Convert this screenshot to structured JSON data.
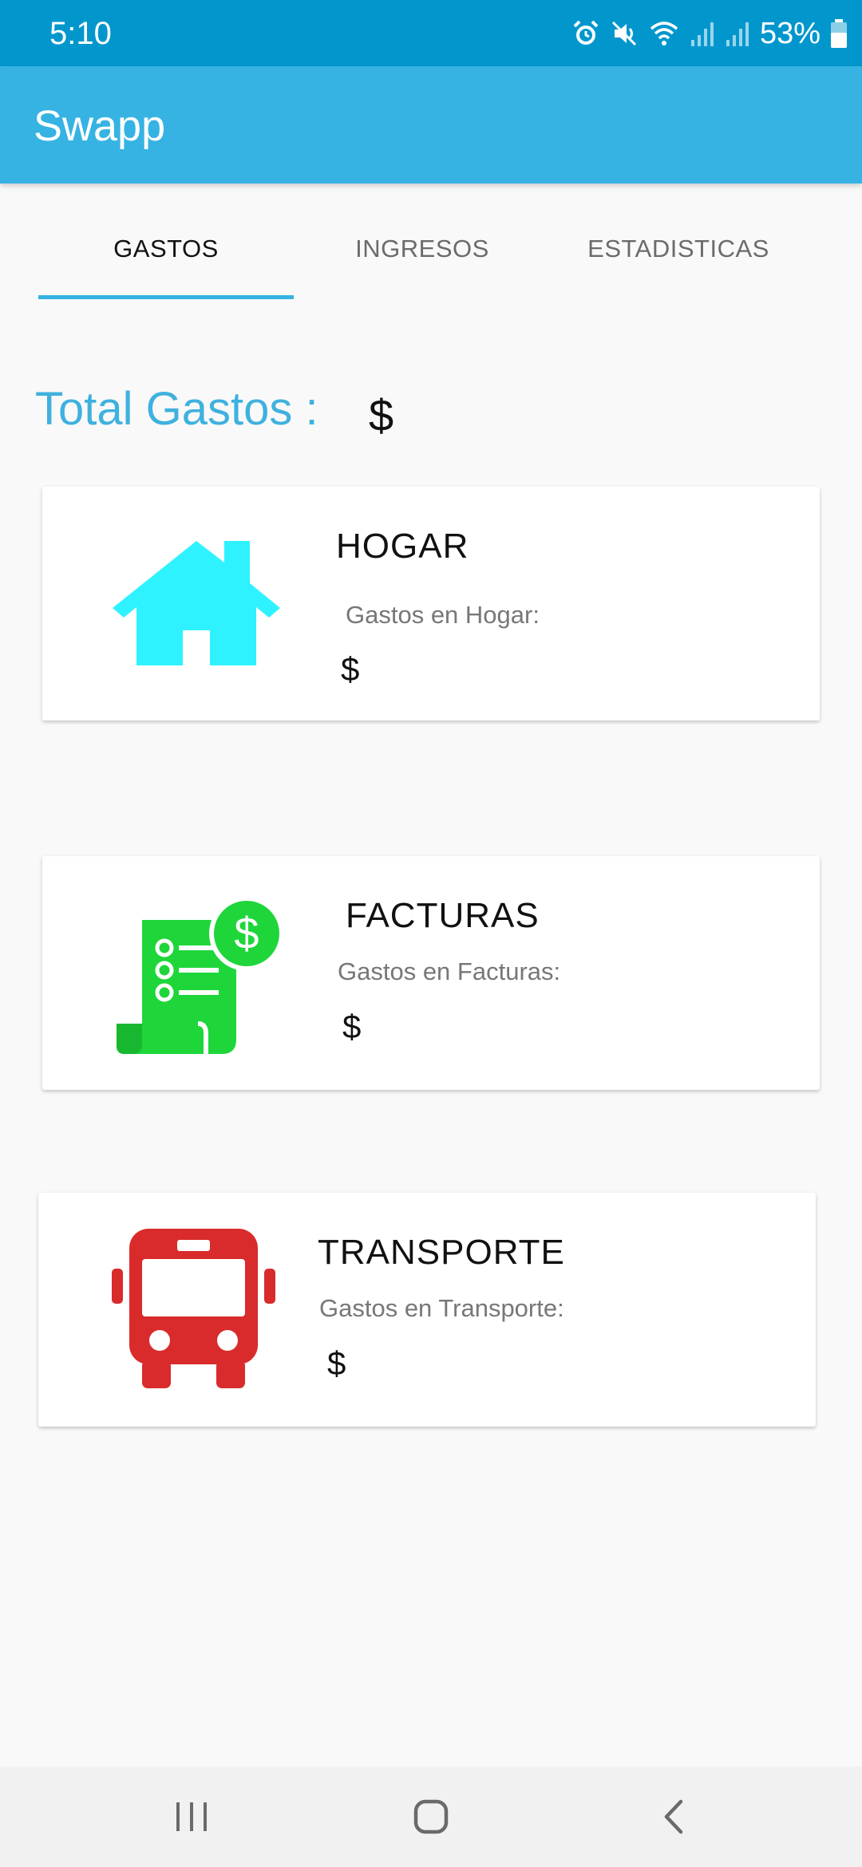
{
  "status_bar": {
    "time": "5:10",
    "battery_percent": "53%",
    "icons": [
      "alarm-icon",
      "mute-icon",
      "wifi-icon",
      "signal-icon",
      "signal-icon",
      "battery-icon"
    ]
  },
  "app_bar": {
    "title": "Swapp"
  },
  "tabs": [
    {
      "label": "GASTOS",
      "active": true
    },
    {
      "label": "INGRESOS",
      "active": false
    },
    {
      "label": "ESTADISTICAS",
      "active": false
    }
  ],
  "total": {
    "label": "Total Gastos :",
    "value": "$"
  },
  "cards": [
    {
      "icon": "house-icon",
      "title": "HOGAR",
      "subtitle": "Gastos en Hogar:",
      "amount": "$",
      "icon_color": "#2ef2ff"
    },
    {
      "icon": "invoice-icon",
      "title": "FACTURAS",
      "subtitle": "Gastos en Facturas:",
      "amount": "$",
      "icon_color": "#1ed63a"
    },
    {
      "icon": "bus-icon",
      "title": "TRANSPORTE",
      "subtitle": "Gastos en Transporte:",
      "amount": "$",
      "icon_color": "#d92b2b"
    }
  ],
  "nav_bar": {
    "buttons": [
      "recents-icon",
      "home-icon",
      "back-icon"
    ]
  },
  "colors": {
    "status_bar": "#0197cd",
    "app_bar": "#36b3e3",
    "accent": "#36b3e3"
  }
}
